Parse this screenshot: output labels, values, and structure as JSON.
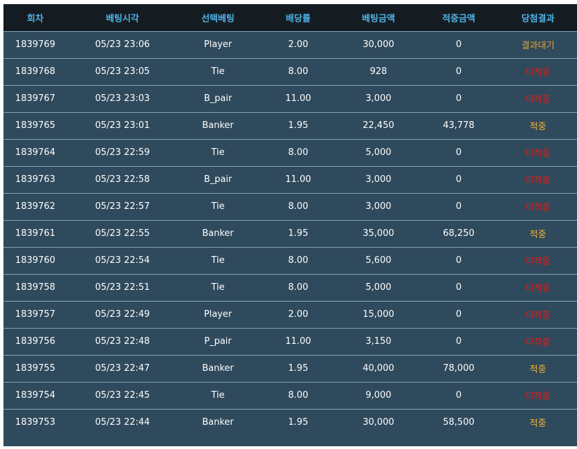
{
  "table": {
    "headers": [
      "회차",
      "베팅시각",
      "선택베팅",
      "배당률",
      "베팅금액",
      "적중금액",
      "당첨결과"
    ],
    "rows": [
      [
        "1839769",
        "05/23 23:06",
        "Player",
        "2.00",
        "30,000",
        "0",
        "결과대기"
      ],
      [
        "1839768",
        "05/23 23:05",
        "Tie",
        "8.00",
        "928",
        "0",
        "미적중"
      ],
      [
        "1839767",
        "05/23 23:03",
        "B_pair",
        "11.00",
        "3,000",
        "0",
        "미적중"
      ],
      [
        "1839765",
        "05/23 23:01",
        "Banker",
        "1.95",
        "22,450",
        "43,778",
        "적중"
      ],
      [
        "1839764",
        "05/23 22:59",
        "Tie",
        "8.00",
        "5,000",
        "0",
        "미적중"
      ],
      [
        "1839763",
        "05/23 22:58",
        "B_pair",
        "11.00",
        "3,000",
        "0",
        "미적중"
      ],
      [
        "1839762",
        "05/23 22:57",
        "Tie",
        "8.00",
        "3,000",
        "0",
        "미적중"
      ],
      [
        "1839761",
        "05/23 22:55",
        "Banker",
        "1.95",
        "35,000",
        "68,250",
        "적중"
      ],
      [
        "1839760",
        "05/23 22:54",
        "Tie",
        "8.00",
        "5,600",
        "0",
        "미적중"
      ],
      [
        "1839758",
        "05/23 22:51",
        "Tie",
        "8.00",
        "5,000",
        "0",
        "미적중"
      ],
      [
        "1839757",
        "05/23 22:49",
        "Player",
        "2.00",
        "15,000",
        "0",
        "미적중"
      ],
      [
        "1839756",
        "05/23 22:48",
        "P_pair",
        "11.00",
        "3,150",
        "0",
        "미적중"
      ],
      [
        "1839755",
        "05/23 22:47",
        "Banker",
        "1.95",
        "40,000",
        "78,000",
        "적중"
      ],
      [
        "1839754",
        "05/23 22:45",
        "Tie",
        "8.00",
        "9,000",
        "0",
        "미적중"
      ],
      [
        "1839753",
        "05/23 22:44",
        "Banker",
        "1.95",
        "30,000",
        "58,500",
        "적중"
      ]
    ],
    "result_classes": [
      "res-wait",
      "res-miss",
      "res-miss",
      "res-hit",
      "res-miss",
      "res-miss",
      "res-miss",
      "res-hit",
      "res-miss",
      "res-miss",
      "res-miss",
      "res-miss",
      "res-hit",
      "res-miss",
      "res-hit"
    ]
  },
  "colors": {
    "header_bg": "#141c22",
    "header_text": "#4fb2e6",
    "row_bg": "#2f4a5c",
    "row_divider": "#7fa6bb",
    "result_wait": "#e6a43a",
    "result_miss": "#e01c1c",
    "result_hit": "#f5b43c"
  }
}
